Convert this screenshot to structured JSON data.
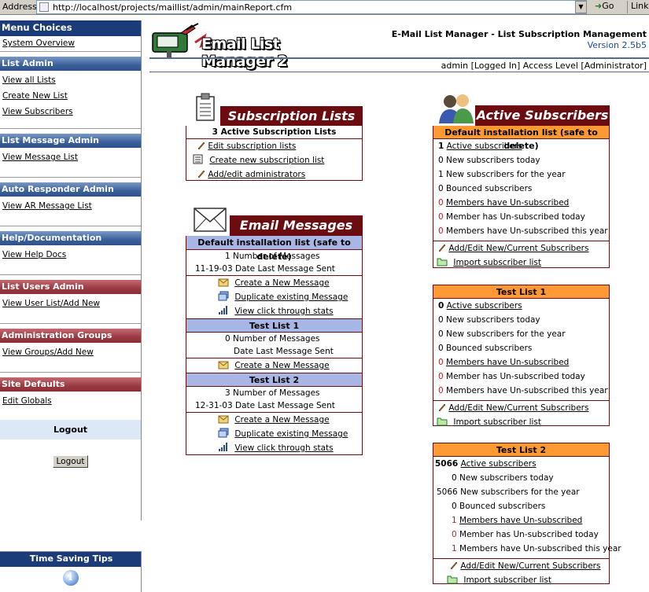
{
  "browser": {
    "address_label": "Address",
    "url": "http://localhost/projects/maillist/admin/mainReport.cfm",
    "go_label": "Go",
    "links_label": "Links"
  },
  "sidebar": {
    "menu_title": "Menu Choices",
    "system_overview": "System Overview",
    "sections": [
      {
        "title": "List Admin",
        "items": [
          "View all Lists",
          "Create New List",
          "View Subscribers"
        ]
      },
      {
        "title": "List Message Admin",
        "items": [
          "View Message List"
        ]
      },
      {
        "title": "Auto Responder Admin",
        "items": [
          "View AR Message List"
        ]
      },
      {
        "title": "Help/Documentation",
        "items": [
          "View Help Docs"
        ]
      },
      {
        "title": "List Users Admin",
        "items": [
          "View User List/Add New"
        ]
      },
      {
        "title": "Administration Groups",
        "items": [
          "View Groups/Add New"
        ]
      },
      {
        "title": "Site Defaults",
        "items": [
          "Edit Globals"
        ]
      }
    ],
    "logout_heading": "Logout",
    "logout_button": "Logout",
    "tips_title": "Time Saving Tips"
  },
  "header": {
    "logo_text": "Email List Manager 2",
    "title": "E-Mail List Manager - List Subscription Management",
    "version": "Version 2.5b5",
    "user_status": "admin [Logged In] Access Level [Administrator]"
  },
  "subscription_lists": {
    "title": "Subscription Lists",
    "count_label": "3 Active Subscription Lists",
    "links": [
      "Edit subscription lists",
      "Create new subscription list",
      "Add/edit administrators"
    ]
  },
  "email_messages": {
    "title": "Email Messages",
    "lists": [
      {
        "name": "Default installation list (safe to delete)",
        "num_messages": "1",
        "num_messages_label": "Number of Messages",
        "date": "11-19-03",
        "date_label": "Date Last Message Sent",
        "links": [
          "Create a New Message",
          "Duplicate existing Message",
          "View click through stats"
        ]
      },
      {
        "name": "Test List 1",
        "num_messages": "0",
        "num_messages_label": "Number of Messages",
        "date": "",
        "date_label": "Date Last Message Sent",
        "links": [
          "Create a New Message"
        ]
      },
      {
        "name": "Test List 2",
        "num_messages": "3",
        "num_messages_label": "Number of Messages",
        "date": "12-31-03",
        "date_label": "Date Last Message Sent",
        "links": [
          "Create a New Message",
          "Duplicate existing Message",
          "View click through stats"
        ]
      }
    ]
  },
  "active_subscribers": {
    "title": "Active Subscribers",
    "stat_labels": {
      "active": "Active subscribers",
      "new_today": "New subscribers today",
      "new_year": "New subscribers for the year",
      "bounced": "Bounced subscribers",
      "unsubscribed": "Members have Un-subscribed",
      "unsub_today": "Member has Un-subscribed today",
      "unsub_year": "Members have Un-subscribed this year"
    },
    "action_links": [
      "Add/Edit New/Current Subscribers",
      "Import subscriber list"
    ],
    "lists": [
      {
        "name": "Default installation list (safe to delete)",
        "active": "1",
        "new_today": "0",
        "new_year": "1",
        "bounced": "0",
        "unsubscribed": "0",
        "unsub_today": "0",
        "unsub_year": "0"
      },
      {
        "name": "Test List 1",
        "active": "0",
        "new_today": "0",
        "new_year": "0",
        "bounced": "0",
        "unsubscribed": "0",
        "unsub_today": "0",
        "unsub_year": "0"
      },
      {
        "name": "Test List 2",
        "active": "5066",
        "new_today": "0",
        "new_year": "5066",
        "bounced": "0",
        "unsubscribed": "1",
        "unsub_today": "0",
        "unsub_year": "1"
      }
    ]
  }
}
